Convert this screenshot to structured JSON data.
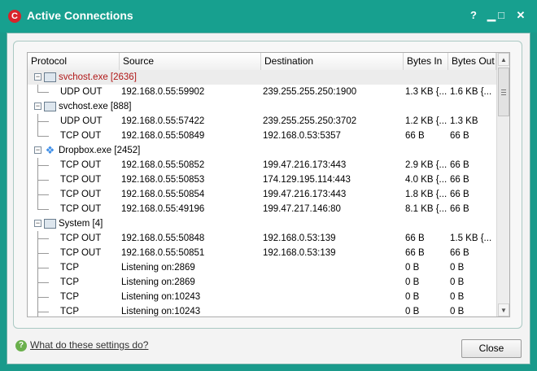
{
  "window": {
    "title": "Active Connections",
    "icon": "C",
    "buttons": {
      "help": "?",
      "minimize": "▁",
      "maximize": "□",
      "close": "✕"
    }
  },
  "columns": [
    "Protocol",
    "Source",
    "Destination",
    "Bytes In",
    "Bytes Out"
  ],
  "rows": [
    {
      "kind": "process",
      "name": "svchost.exe [2636]",
      "icon": "window-icon",
      "highlight": true
    },
    {
      "kind": "conn",
      "protocol": "UDP OUT",
      "source": "192.168.0.55:59902",
      "destination": "239.255.255.250:1900",
      "bytes_in": "1.3 KB {...",
      "bytes_out": "1.6 KB {...",
      "last": true
    },
    {
      "kind": "process",
      "name": "svchost.exe [888]",
      "icon": "window-icon"
    },
    {
      "kind": "conn",
      "protocol": "UDP OUT",
      "source": "192.168.0.55:57422",
      "destination": "239.255.255.250:3702",
      "bytes_in": "1.2 KB {...",
      "bytes_out": "1.3 KB"
    },
    {
      "kind": "conn",
      "protocol": "TCP OUT",
      "source": "192.168.0.55:50849",
      "destination": "192.168.0.53:5357",
      "bytes_in": "66 B",
      "bytes_out": "66 B",
      "last": true
    },
    {
      "kind": "process",
      "name": "Dropbox.exe [2452]",
      "icon": "dropbox-icon"
    },
    {
      "kind": "conn",
      "protocol": "TCP OUT",
      "source": "192.168.0.55:50852",
      "destination": "199.47.216.173:443",
      "bytes_in": "2.9 KB {...",
      "bytes_out": "66 B"
    },
    {
      "kind": "conn",
      "protocol": "TCP OUT",
      "source": "192.168.0.55:50853",
      "destination": "174.129.195.114:443",
      "bytes_in": "4.0 KB {...",
      "bytes_out": "66 B"
    },
    {
      "kind": "conn",
      "protocol": "TCP OUT",
      "source": "192.168.0.55:50854",
      "destination": "199.47.216.173:443",
      "bytes_in": "1.8 KB {...",
      "bytes_out": "66 B"
    },
    {
      "kind": "conn",
      "protocol": "TCP OUT",
      "source": "192.168.0.55:49196",
      "destination": "199.47.217.146:80",
      "bytes_in": "8.1 KB {...",
      "bytes_out": "66 B",
      "last": true
    },
    {
      "kind": "process",
      "name": "System [4]",
      "icon": "window-icon"
    },
    {
      "kind": "conn",
      "protocol": "TCP OUT",
      "source": "192.168.0.55:50848",
      "destination": "192.168.0.53:139",
      "bytes_in": "66 B",
      "bytes_out": "1.5 KB {..."
    },
    {
      "kind": "conn",
      "protocol": "TCP OUT",
      "source": "192.168.0.55:50851",
      "destination": "192.168.0.53:139",
      "bytes_in": "66 B",
      "bytes_out": "66 B"
    },
    {
      "kind": "conn",
      "protocol": "TCP",
      "source": "Listening on:2869",
      "destination": "",
      "bytes_in": "0 B",
      "bytes_out": "0 B"
    },
    {
      "kind": "conn",
      "protocol": "TCP",
      "source": "Listening on:2869",
      "destination": "",
      "bytes_in": "0 B",
      "bytes_out": "0 B"
    },
    {
      "kind": "conn",
      "protocol": "TCP",
      "source": "Listening on:10243",
      "destination": "",
      "bytes_in": "0 B",
      "bytes_out": "0 B"
    },
    {
      "kind": "conn",
      "protocol": "TCP",
      "source": "Listening on:10243",
      "destination": "",
      "bytes_in": "0 B",
      "bytes_out": "0 B"
    }
  ],
  "scrollbar": {
    "up": "▲",
    "down": "▼"
  },
  "footer": {
    "help_icon": "?",
    "help_link": "What do these settings do?",
    "close_label": "Close"
  },
  "colors": {
    "accent": "#1a9a8b",
    "highlight_text": "#b01717"
  }
}
